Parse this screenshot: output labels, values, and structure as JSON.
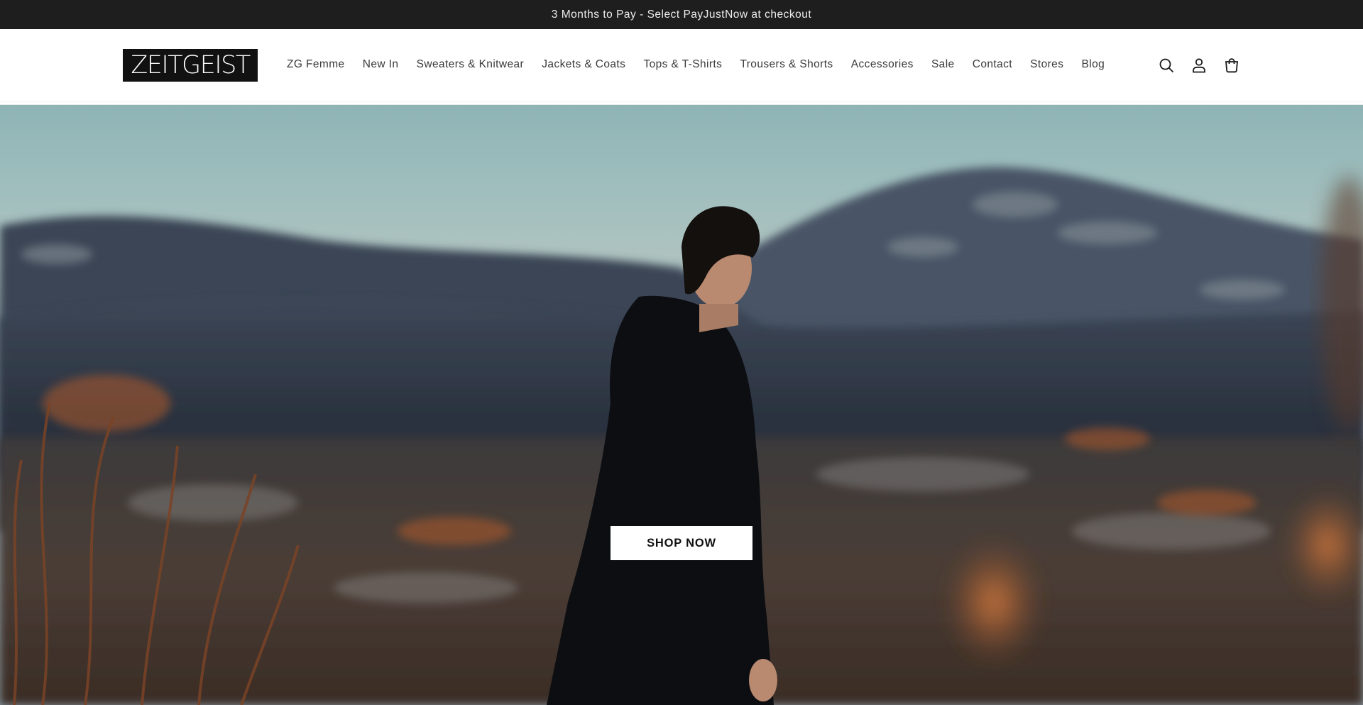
{
  "announcement": {
    "text": "3 Months to Pay - Select PayJustNow at checkout"
  },
  "brand": {
    "logo_text": "ZEITGEIST"
  },
  "nav": {
    "items": [
      {
        "label": "ZG Femme"
      },
      {
        "label": "New In"
      },
      {
        "label": "Sweaters & Knitwear"
      },
      {
        "label": "Jackets & Coats"
      },
      {
        "label": "Tops & T-Shirts"
      },
      {
        "label": "Trousers & Shorts"
      },
      {
        "label": "Accessories"
      },
      {
        "label": "Sale"
      },
      {
        "label": "Contact"
      },
      {
        "label": "Stores"
      },
      {
        "label": "Blog"
      }
    ]
  },
  "header_icons": [
    "search-icon",
    "account-icon",
    "cart-icon"
  ],
  "hero": {
    "cta_label": "SHOP NOW"
  },
  "colors": {
    "announcement_bg": "#1e1e1e",
    "logo_bg": "#111111",
    "button_bg": "#ffffff"
  }
}
